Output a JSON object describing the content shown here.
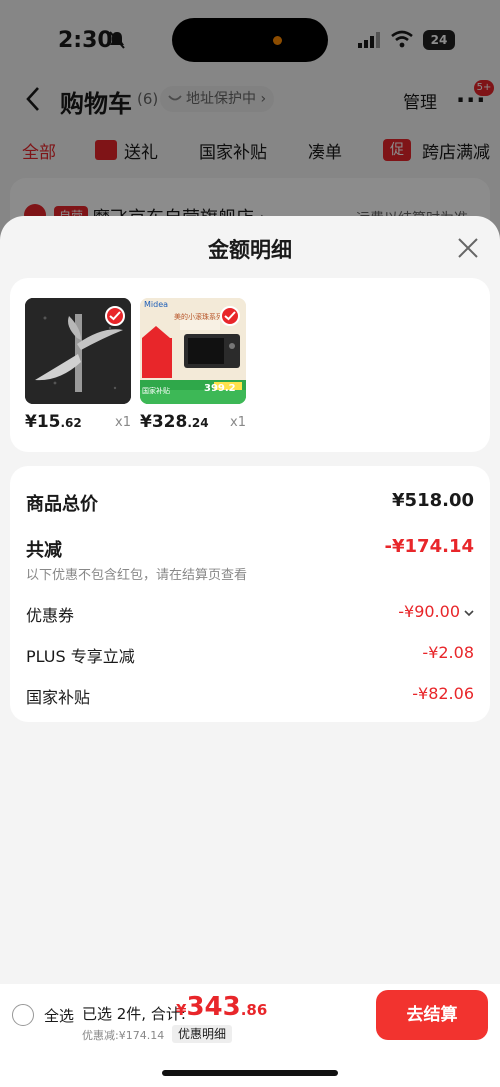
{
  "status_bar": {
    "time": "2:30",
    "battery": "24"
  },
  "header": {
    "title": "购物车",
    "count": "(6)",
    "address_protect": "地址保护中 ›",
    "manage": "管理",
    "more_badge": "5+"
  },
  "filter_tabs": {
    "all": "全部",
    "gift": "送礼",
    "national_subsidy": "国家补贴",
    "combine": "凑单",
    "promo_icon": "促",
    "cross_store": "跨店满减"
  },
  "store": {
    "tag": "自营",
    "name": "魔飞京东自营旗舰店 ›",
    "shipping": "运费以结算时为准"
  },
  "sheet": {
    "title": "金额明细",
    "products": [
      {
        "price_int": "¥15",
        "price_dec": ".62",
        "qty": "x1"
      },
      {
        "price_int": "¥328",
        "price_dec": ".24",
        "qty": "x1"
      }
    ],
    "product_thumb_text": {
      "brand": "Midea",
      "slogan": "美的小滚珠系列",
      "badge": "国家补贴",
      "price": "399.2"
    },
    "details": {
      "total_label": "商品总价",
      "total_value": "¥518.00",
      "discount_label": "共减",
      "discount_value": "-¥174.14",
      "discount_note": "以下优惠不包含红包，请在结算页查看",
      "coupon_label": "优惠券",
      "coupon_value": "-¥90.00",
      "plus_label": "PLUS 专享立减",
      "plus_value": "-¥2.08",
      "subsidy_label": "国家补贴",
      "subsidy_value": "-¥82.06"
    }
  },
  "checkout": {
    "select_all": "全选",
    "summary": "已选 2件, 合计:",
    "total_yen": "¥",
    "total_int": "343",
    "total_dec": ".86",
    "saved": "优惠减:¥174.14",
    "detail_link": "优惠明细",
    "button": "去结算"
  },
  "colors": {
    "accent": "#e8262a",
    "checkout_button": "#f2332f"
  }
}
